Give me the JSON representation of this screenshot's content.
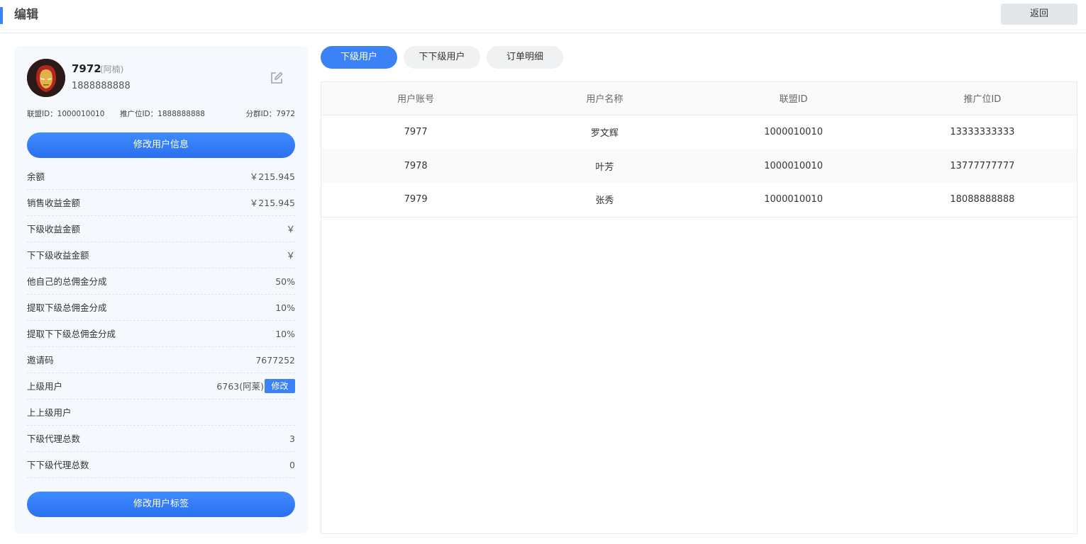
{
  "header": {
    "title": "编辑",
    "back_label": "返回"
  },
  "profile": {
    "uid": "7972",
    "nickname": "(阿楠)",
    "phone": "1888888888",
    "alliance_id_text": "联盟ID：1000010010",
    "promo_id_text": "推广位ID：1888888888",
    "group_id_text": "分群ID：7972",
    "edit_info_label": "修改用户信息",
    "edit_tags_label": "修改用户标签"
  },
  "stats": [
    {
      "label": "余额",
      "value": "￥215.945"
    },
    {
      "label": "销售收益金额",
      "value": "￥215.945"
    },
    {
      "label": "下级收益金额",
      "value": "￥"
    },
    {
      "label": "下下级收益金额",
      "value": "￥"
    },
    {
      "label": "他自己的总佣金分成",
      "value": "50%"
    },
    {
      "label": "提取下级总佣金分成",
      "value": "10%"
    },
    {
      "label": "提取下下级总佣金分成",
      "value": "10%"
    },
    {
      "label": "邀请码",
      "value": "7677252"
    },
    {
      "label": "上级用户",
      "value": "6763(阿莱)",
      "action": "修改"
    },
    {
      "label": "上上级用户",
      "value": ""
    },
    {
      "label": "下级代理总数",
      "value": "3"
    },
    {
      "label": "下下级代理总数",
      "value": "0"
    }
  ],
  "tabs": [
    {
      "label": "下级用户",
      "active": true
    },
    {
      "label": "下下级用户",
      "active": false
    },
    {
      "label": "订单明细",
      "active": false
    }
  ],
  "table": {
    "columns": [
      "用户账号",
      "用户名称",
      "联盟ID",
      "推广位ID"
    ],
    "rows": [
      [
        "7977",
        "罗文辉",
        "1000010010",
        "13333333333"
      ],
      [
        "7978",
        "叶芳",
        "1000010010",
        "13777777777"
      ],
      [
        "7979",
        "张秀",
        "1000010010",
        "18088888888"
      ]
    ]
  },
  "colors": {
    "accent": "#3b82f6",
    "card_bg": "#f5f8fc",
    "back_button_bg": "#e4e7ea"
  }
}
